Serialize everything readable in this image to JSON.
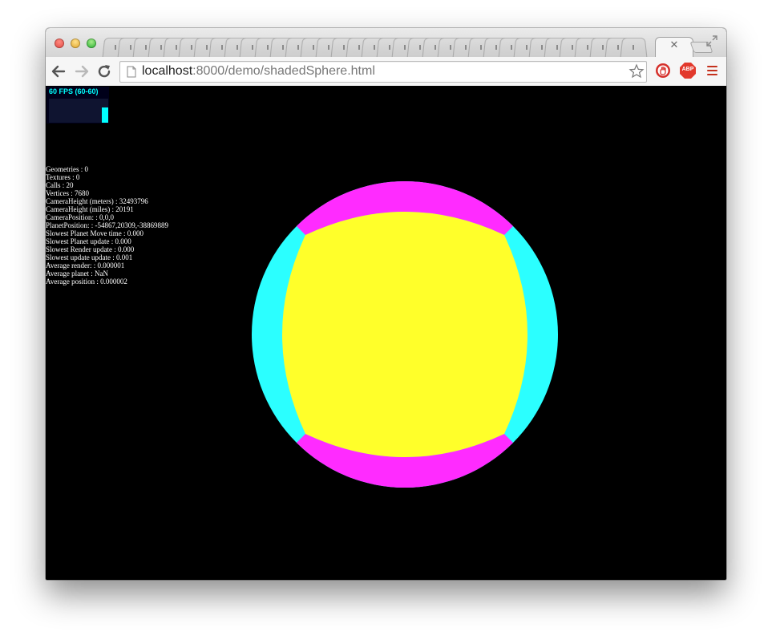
{
  "browser": {
    "url_host": "localhost",
    "url_rest": ":8000/demo/shadedSphere.html",
    "tab_close": "✕",
    "extensions": {
      "abp_label": "ABP"
    }
  },
  "fps": {
    "label": "60 FPS (60-60)",
    "color": "#00ffff",
    "level": 1.0
  },
  "stats": [
    "Geometries : 0",
    "Textures : 0",
    "Calls : 20",
    "Vertices : 7680",
    "CameraHeight (meters) : 32493796",
    "CameraHeight (miles) : 20191",
    "CameraPosition: : 0,0,0",
    "PlanetPosition: : -54867,20309,-38869889",
    "Slowest Planet Move time : 0.000",
    "Slowest Planet update : 0.000",
    "Slowest Render update : 0.000",
    "Slowest update update : 0.001",
    "Average render: : 0.000001",
    "Average planet : NaN",
    "Average position : 0.000002"
  ],
  "sphere_colors": {
    "face_front": "#ffff2a",
    "faces_top_bottom": "#ff2bff",
    "faces_left_right": "#2bffff"
  }
}
